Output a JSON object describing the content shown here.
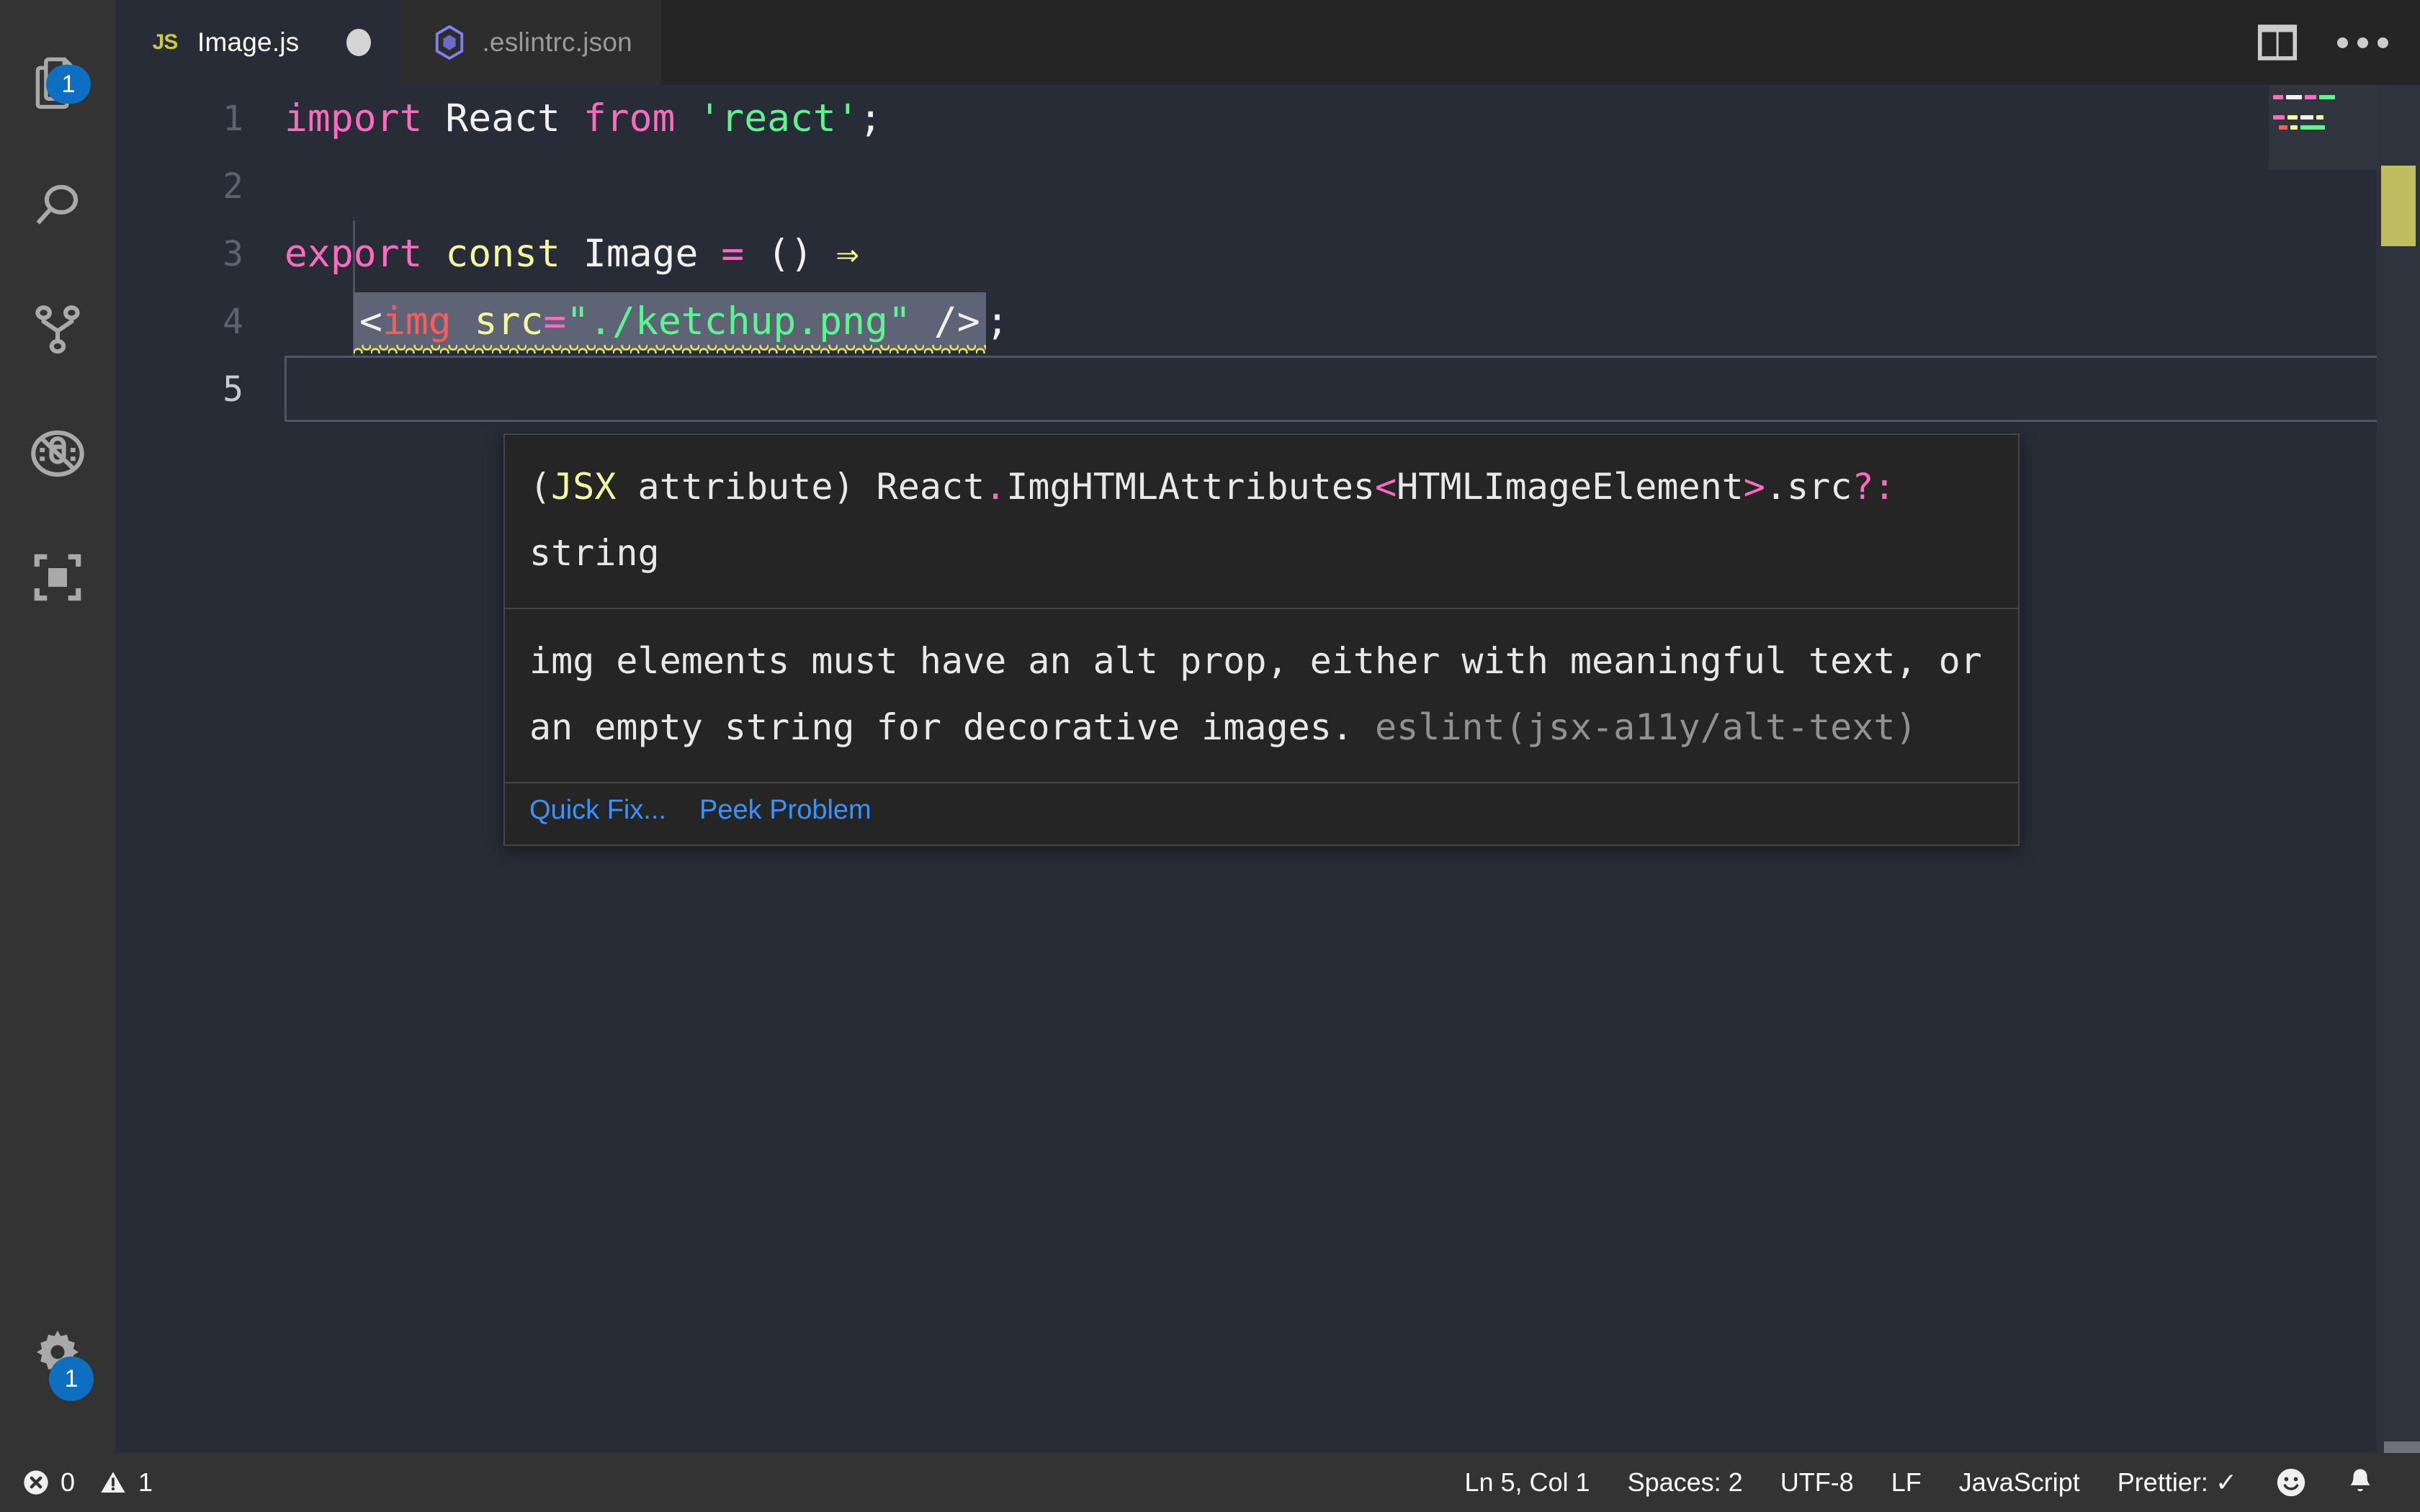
{
  "window": {
    "app": "Visual Studio Code",
    "theme_colors": {
      "editor_bg": "#282c36",
      "activity_bar_bg": "#333333",
      "tabbar_bg": "#252526",
      "inactive_tab_bg": "#2d2d2d",
      "status_bar_bg": "#333333",
      "hover_bg": "#252526",
      "hover_border": "#454545",
      "badge_blue": "#0e6fc1",
      "link_blue": "#3794ff",
      "warning_yellow": "#e8e84a",
      "selection_bg": "#5e6475"
    }
  },
  "activity_bar": {
    "items": [
      {
        "name": "explorer",
        "icon": "files-icon",
        "badge": "1"
      },
      {
        "name": "search",
        "icon": "search-icon",
        "badge": ""
      },
      {
        "name": "source-control",
        "icon": "git-branch-icon",
        "badge": ""
      },
      {
        "name": "run-and-debug",
        "icon": "debug-icon",
        "badge": ""
      },
      {
        "name": "extensions",
        "icon": "extensions-icon",
        "badge": ""
      }
    ],
    "bottom": [
      {
        "name": "manage-settings",
        "icon": "gear-icon",
        "badge": "1"
      }
    ]
  },
  "tabs": [
    {
      "label": "Image.js",
      "icon": "js-file-icon",
      "icon_text": "JS",
      "active": true,
      "dirty": true
    },
    {
      "label": ".eslintrc.json",
      "icon": "eslint-file-icon",
      "icon_text": "",
      "active": false,
      "dirty": false
    }
  ],
  "editor_actions": [
    {
      "name": "split-editor-right",
      "icon": "split-editor-icon"
    },
    {
      "name": "more-actions",
      "icon": "ellipsis-icon"
    }
  ],
  "editor": {
    "language": "JavaScript",
    "lines": [
      {
        "number": "1",
        "tokens": [
          {
            "text": "import ",
            "cls": "t-kw"
          },
          {
            "text": "React",
            "cls": "t-plain"
          },
          {
            "text": " from ",
            "cls": "t-kw"
          },
          {
            "text": "'react'",
            "cls": "t-str"
          },
          {
            "text": ";",
            "cls": "t-punct"
          }
        ]
      },
      {
        "number": "2",
        "tokens": []
      },
      {
        "number": "3",
        "tokens": [
          {
            "text": "export ",
            "cls": "t-kw"
          },
          {
            "text": "const ",
            "cls": "t-kw2"
          },
          {
            "text": "Image",
            "cls": "t-plain"
          },
          {
            "text": " ",
            "cls": "t-plain"
          },
          {
            "text": "=",
            "cls": "t-op"
          },
          {
            "text": " ",
            "cls": "t-plain"
          },
          {
            "text": "()",
            "cls": "t-punct"
          },
          {
            "text": " ",
            "cls": "t-plain"
          },
          {
            "text": "⇒",
            "cls": "t-arrow"
          }
        ]
      },
      {
        "number": "4",
        "selected": true,
        "warning": true,
        "tokens": [
          {
            "text": "<",
            "cls": "t-punct"
          },
          {
            "text": "img",
            "cls": "t-tagname"
          },
          {
            "text": " ",
            "cls": "t-plain"
          },
          {
            "text": "src",
            "cls": "t-attr"
          },
          {
            "text": "=",
            "cls": "t-op"
          },
          {
            "text": "\"./ketchup.png\"",
            "cls": "t-str"
          },
          {
            "text": " ",
            "cls": "t-plain"
          },
          {
            "text": "/>",
            "cls": "t-punct"
          }
        ],
        "trailing": [
          {
            "text": ";",
            "cls": "t-punct"
          }
        ]
      },
      {
        "number": "5",
        "active": true,
        "tokens": []
      }
    ]
  },
  "hover": {
    "signature": [
      {
        "text": "(",
        "cls": "hw-t-plain"
      },
      {
        "text": "JSX",
        "cls": "hw-t-jsx"
      },
      {
        "text": " attribute) React",
        "cls": "hw-t-plain"
      },
      {
        "text": ".",
        "cls": "hw-t-punct"
      },
      {
        "text": "ImgHTMLAttributes",
        "cls": "hw-t-plain"
      },
      {
        "text": "<",
        "cls": "hw-t-punct"
      },
      {
        "text": "HTMLImageElement",
        "cls": "hw-t-plain"
      },
      {
        "text": ">",
        "cls": "hw-t-punct"
      },
      {
        "text": ".src",
        "cls": "hw-t-plain"
      },
      {
        "text": "?:",
        "cls": "hw-t-punct"
      },
      {
        "text": " string",
        "cls": "hw-t-plain"
      }
    ],
    "message": "img elements must have an alt prop, either with meaningful text, or an empty string for decorative images.",
    "rule": "eslint(jsx-a11y/alt-text)",
    "actions": [
      {
        "label": "Quick Fix...",
        "name": "quick-fix-link"
      },
      {
        "label": "Peek Problem",
        "name": "peek-problem-link"
      }
    ]
  },
  "status_bar": {
    "left": [
      {
        "name": "error-count",
        "icon": "error-icon",
        "value": "0"
      },
      {
        "name": "warning-count",
        "icon": "warning-icon",
        "value": "1"
      }
    ],
    "right": [
      {
        "name": "cursor-position",
        "value": "Ln 5, Col 1"
      },
      {
        "name": "indentation",
        "value": "Spaces: 2"
      },
      {
        "name": "encoding",
        "value": "UTF-8"
      },
      {
        "name": "line-endings",
        "value": "LF"
      },
      {
        "name": "language-mode",
        "value": "JavaScript"
      },
      {
        "name": "prettier-status",
        "value": "Prettier: ✓"
      },
      {
        "name": "feedback",
        "value": "",
        "icon": "smiley-icon"
      },
      {
        "name": "notifications",
        "value": "",
        "icon": "bell-icon"
      }
    ]
  }
}
